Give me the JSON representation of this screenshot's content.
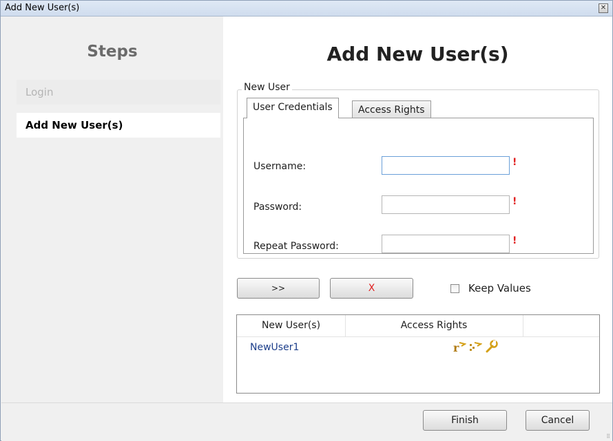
{
  "window": {
    "title": "Add New User(s)",
    "close_icon": "close-icon"
  },
  "sidebar": {
    "title": "Steps",
    "steps": [
      {
        "label": "Login",
        "state": "inactive"
      },
      {
        "label": "Add New User(s)",
        "state": "active"
      }
    ]
  },
  "main": {
    "title": "Add New User(s)",
    "group_title": "New User",
    "tabs": [
      {
        "label": "User Credentials",
        "selected": true
      },
      {
        "label": "Access Rights",
        "selected": false
      }
    ],
    "fields": [
      {
        "label": "Username:",
        "value": "",
        "required_marker": "!"
      },
      {
        "label": "Password:",
        "value": "",
        "required_marker": "!"
      },
      {
        "label": "Repeat Password:",
        "value": "",
        "required_marker": "!"
      }
    ],
    "next_button": ">>",
    "remove_button": "X",
    "keep_values": {
      "label": "Keep Values",
      "checked": false
    },
    "grid": {
      "columns": [
        "New User(s)",
        "Access Rights"
      ],
      "rows": [
        {
          "user": "NewUser1",
          "rights_icons": [
            "read-rights-icon",
            "write-rights-icon",
            "admin-wrench-icon"
          ]
        }
      ]
    }
  },
  "footer": {
    "finish": "Finish",
    "cancel": "Cancel"
  },
  "colors": {
    "accent_blue": "#1c3e8a",
    "required_red": "#e02020",
    "wrench_gold": "#e0b020"
  }
}
